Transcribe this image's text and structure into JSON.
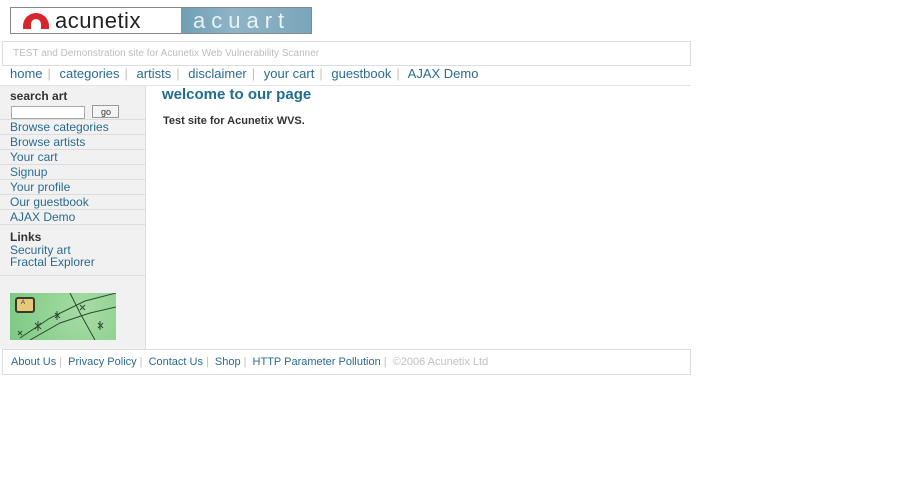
{
  "logo": {
    "left_text": "acunetix",
    "right_text": "acuart"
  },
  "tagline": "TEST and Demonstration site for Acunetix Web Vulnerability Scanner",
  "topnav": [
    {
      "label": "home"
    },
    {
      "label": "categories"
    },
    {
      "label": "artists"
    },
    {
      "label": "disclaimer"
    },
    {
      "label": "your cart"
    },
    {
      "label": "guestbook"
    },
    {
      "label": "AJAX Demo"
    }
  ],
  "topnav_separator": "|",
  "search": {
    "label": "search art",
    "value": "",
    "placeholder": "",
    "button": "go"
  },
  "sidebar": {
    "items": [
      {
        "label": "Browse categories"
      },
      {
        "label": "Browse artists"
      },
      {
        "label": "Your cart"
      },
      {
        "label": "Signup"
      },
      {
        "label": "Your profile"
      },
      {
        "label": "Our guestbook"
      },
      {
        "label": "AJAX Demo"
      }
    ],
    "links_title": "Links",
    "links": [
      {
        "label": "Security art"
      },
      {
        "label": "Fractal Explorer"
      }
    ],
    "image_badge": "A"
  },
  "content": {
    "heading": "welcome to our page",
    "text": "Test site for Acunetix WVS."
  },
  "footer": {
    "links": [
      {
        "label": "About Us"
      },
      {
        "label": "Privacy Policy"
      },
      {
        "label": "Contact Us"
      },
      {
        "label": "Shop"
      },
      {
        "label": "HTTP Parameter Pollution"
      }
    ],
    "separator": "|",
    "copyright": "©2006 Acunetix Ltd"
  },
  "colors": {
    "link": "#2a6b8f",
    "heading": "#1d6c91",
    "sidebar_bg": "#f1f1f1",
    "logo_red": "#d9262c"
  }
}
